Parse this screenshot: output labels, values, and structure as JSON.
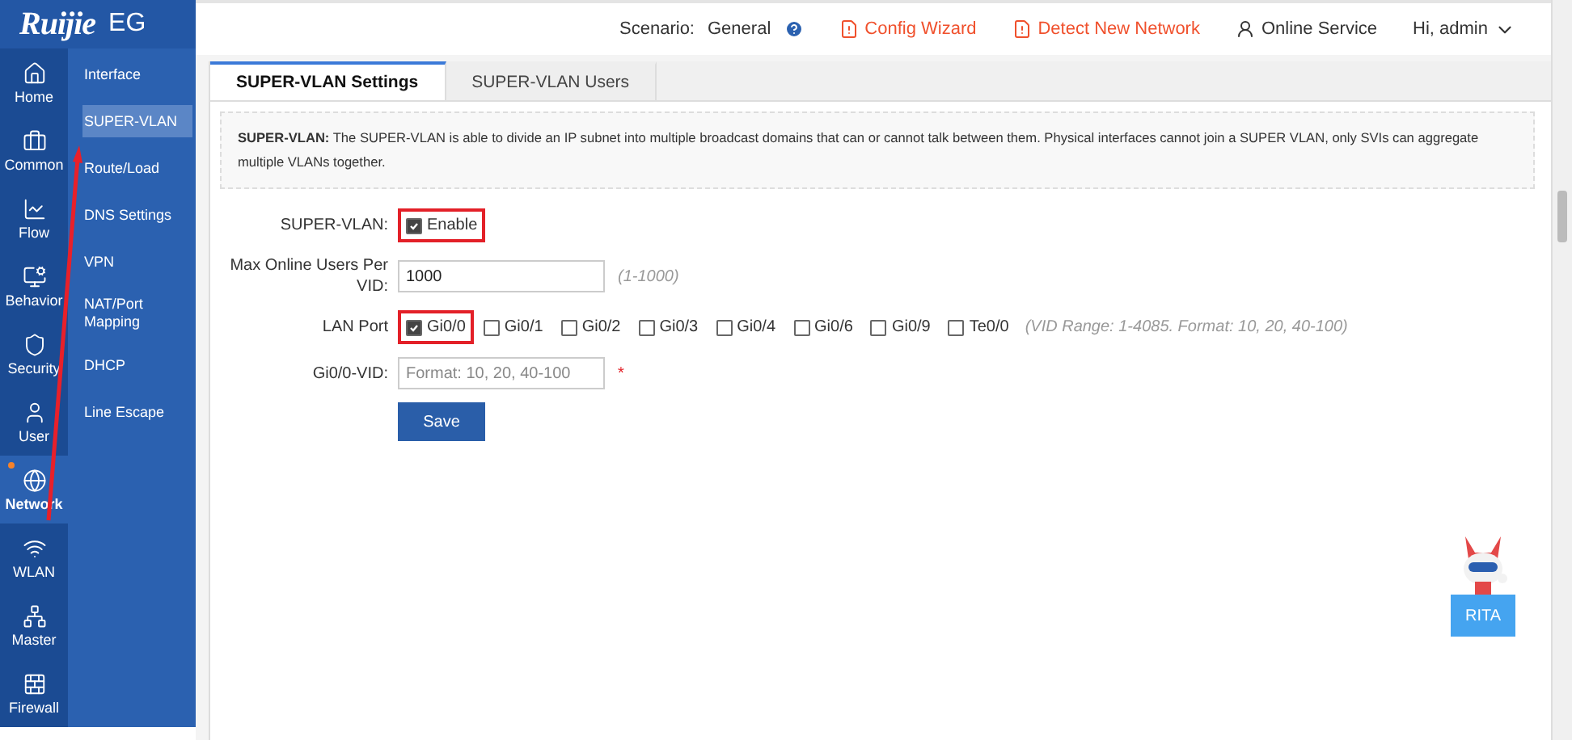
{
  "logo": {
    "brand": "Ruijie",
    "product": "EG"
  },
  "rail": [
    {
      "label": "Home",
      "selected": false,
      "dot": false
    },
    {
      "label": "Common",
      "selected": false,
      "dot": false
    },
    {
      "label": "Flow",
      "selected": false,
      "dot": false
    },
    {
      "label": "Behavior",
      "selected": false,
      "dot": false
    },
    {
      "label": "Security",
      "selected": false,
      "dot": false
    },
    {
      "label": "User",
      "selected": false,
      "dot": false
    },
    {
      "label": "Network",
      "selected": true,
      "dot": true
    },
    {
      "label": "WLAN",
      "selected": false,
      "dot": false
    },
    {
      "label": "Master",
      "selected": false,
      "dot": false
    },
    {
      "label": "Firewall",
      "selected": false,
      "dot": false
    }
  ],
  "submenu": [
    {
      "label": "Interface",
      "selected": false
    },
    {
      "label": "SUPER-VLAN",
      "selected": true
    },
    {
      "label": "Route/Load",
      "selected": false
    },
    {
      "label": "DNS Settings",
      "selected": false
    },
    {
      "label": "VPN",
      "selected": false
    },
    {
      "label": "NAT/Port Mapping",
      "selected": false
    },
    {
      "label": "DHCP",
      "selected": false
    },
    {
      "label": "Line Escape",
      "selected": false
    }
  ],
  "header": {
    "scenario_label": "Scenario:",
    "scenario_value": "General",
    "links": [
      {
        "label": "Config Wizard",
        "kind": "alert"
      },
      {
        "label": "Detect New Network",
        "kind": "alert"
      },
      {
        "label": "Online Service",
        "kind": "plain"
      }
    ],
    "user": "Hi, admin"
  },
  "tabs": [
    {
      "label": "SUPER-VLAN Settings",
      "selected": true
    },
    {
      "label": "SUPER-VLAN Users",
      "selected": false
    }
  ],
  "info": "**SUPER-VLAN:** The SUPER-VLAN is able to divide an IP subnet into multiple broadcast domains that can or cannot talk between them. Physical interfaces cannot join a SUPER VLAN, only SVIs can aggregate multiple VLANs together.",
  "form": {
    "enable_label": "SUPER-VLAN:",
    "enable": {
      "label": "Enable",
      "checked": true,
      "highlighted": true
    },
    "max_label": "Max Online Users Per VID:",
    "max_value": "1000",
    "max_hint": "(1-1000)",
    "lan_label": "LAN Port",
    "ports": [
      {
        "label": "Gi0/0",
        "checked": true,
        "highlighted": true
      },
      {
        "label": "Gi0/1",
        "checked": false,
        "highlighted": false
      },
      {
        "label": "Gi0/2",
        "checked": false,
        "highlighted": false
      },
      {
        "label": "Gi0/3",
        "checked": false,
        "highlighted": false
      },
      {
        "label": "Gi0/4",
        "checked": false,
        "highlighted": false
      },
      {
        "label": "Gi0/6",
        "checked": false,
        "highlighted": false
      },
      {
        "label": "Gi0/9",
        "checked": false,
        "highlighted": false
      },
      {
        "label": "Te0/0",
        "checked": false,
        "highlighted": false
      }
    ],
    "lan_hint": "(VID Range: 1-4085. Format: 10, 20, 40-100)",
    "vid_label": "Gi0/0-VID:",
    "vid_placeholder": "Format: 10, 20, 40-100",
    "required_mark": "*",
    "save": "Save"
  },
  "assistant": {
    "label": "RITA"
  }
}
